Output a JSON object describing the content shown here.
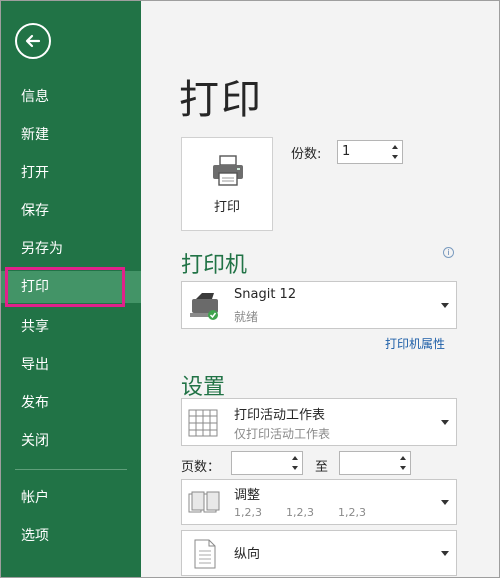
{
  "sidebar": {
    "items": [
      {
        "label": "信息"
      },
      {
        "label": "新建"
      },
      {
        "label": "打开"
      },
      {
        "label": "保存"
      },
      {
        "label": "另存为"
      },
      {
        "label": "打印",
        "active": true
      },
      {
        "label": "共享"
      },
      {
        "label": "导出"
      },
      {
        "label": "发布"
      },
      {
        "label": "关闭"
      },
      {
        "label": "帐户"
      },
      {
        "label": "选项"
      }
    ]
  },
  "main": {
    "title": "打印",
    "print_button_label": "打印",
    "copies": {
      "label": "份数:",
      "value": "1"
    },
    "printer": {
      "section_title": "打印机",
      "name": "Snagit 12",
      "status": "就绪",
      "properties_link": "打印机属性"
    },
    "settings": {
      "section_title": "设置",
      "scope": {
        "title": "打印活动工作表",
        "subtitle": "仅打印活动工作表"
      },
      "pages": {
        "label": "页数：",
        "to_label": "至",
        "from_value": "",
        "to_value": ""
      },
      "collate": {
        "title": "调整",
        "subtitle_parts": [
          "1,2,3",
          "1,2,3",
          "1,2,3"
        ]
      },
      "orientation": {
        "title": "纵向"
      }
    }
  },
  "colors": {
    "accent": "#217346",
    "active_nav": "#439467",
    "highlight": "#e0218a",
    "link": "#1e5fa8"
  },
  "icons": [
    "back-arrow-icon",
    "printer-icon",
    "info-icon",
    "spin-up-icon",
    "spin-down-icon",
    "dropdown-arrow-icon",
    "sheet-grid-icon",
    "collate-pages-icon",
    "portrait-page-icon"
  ]
}
